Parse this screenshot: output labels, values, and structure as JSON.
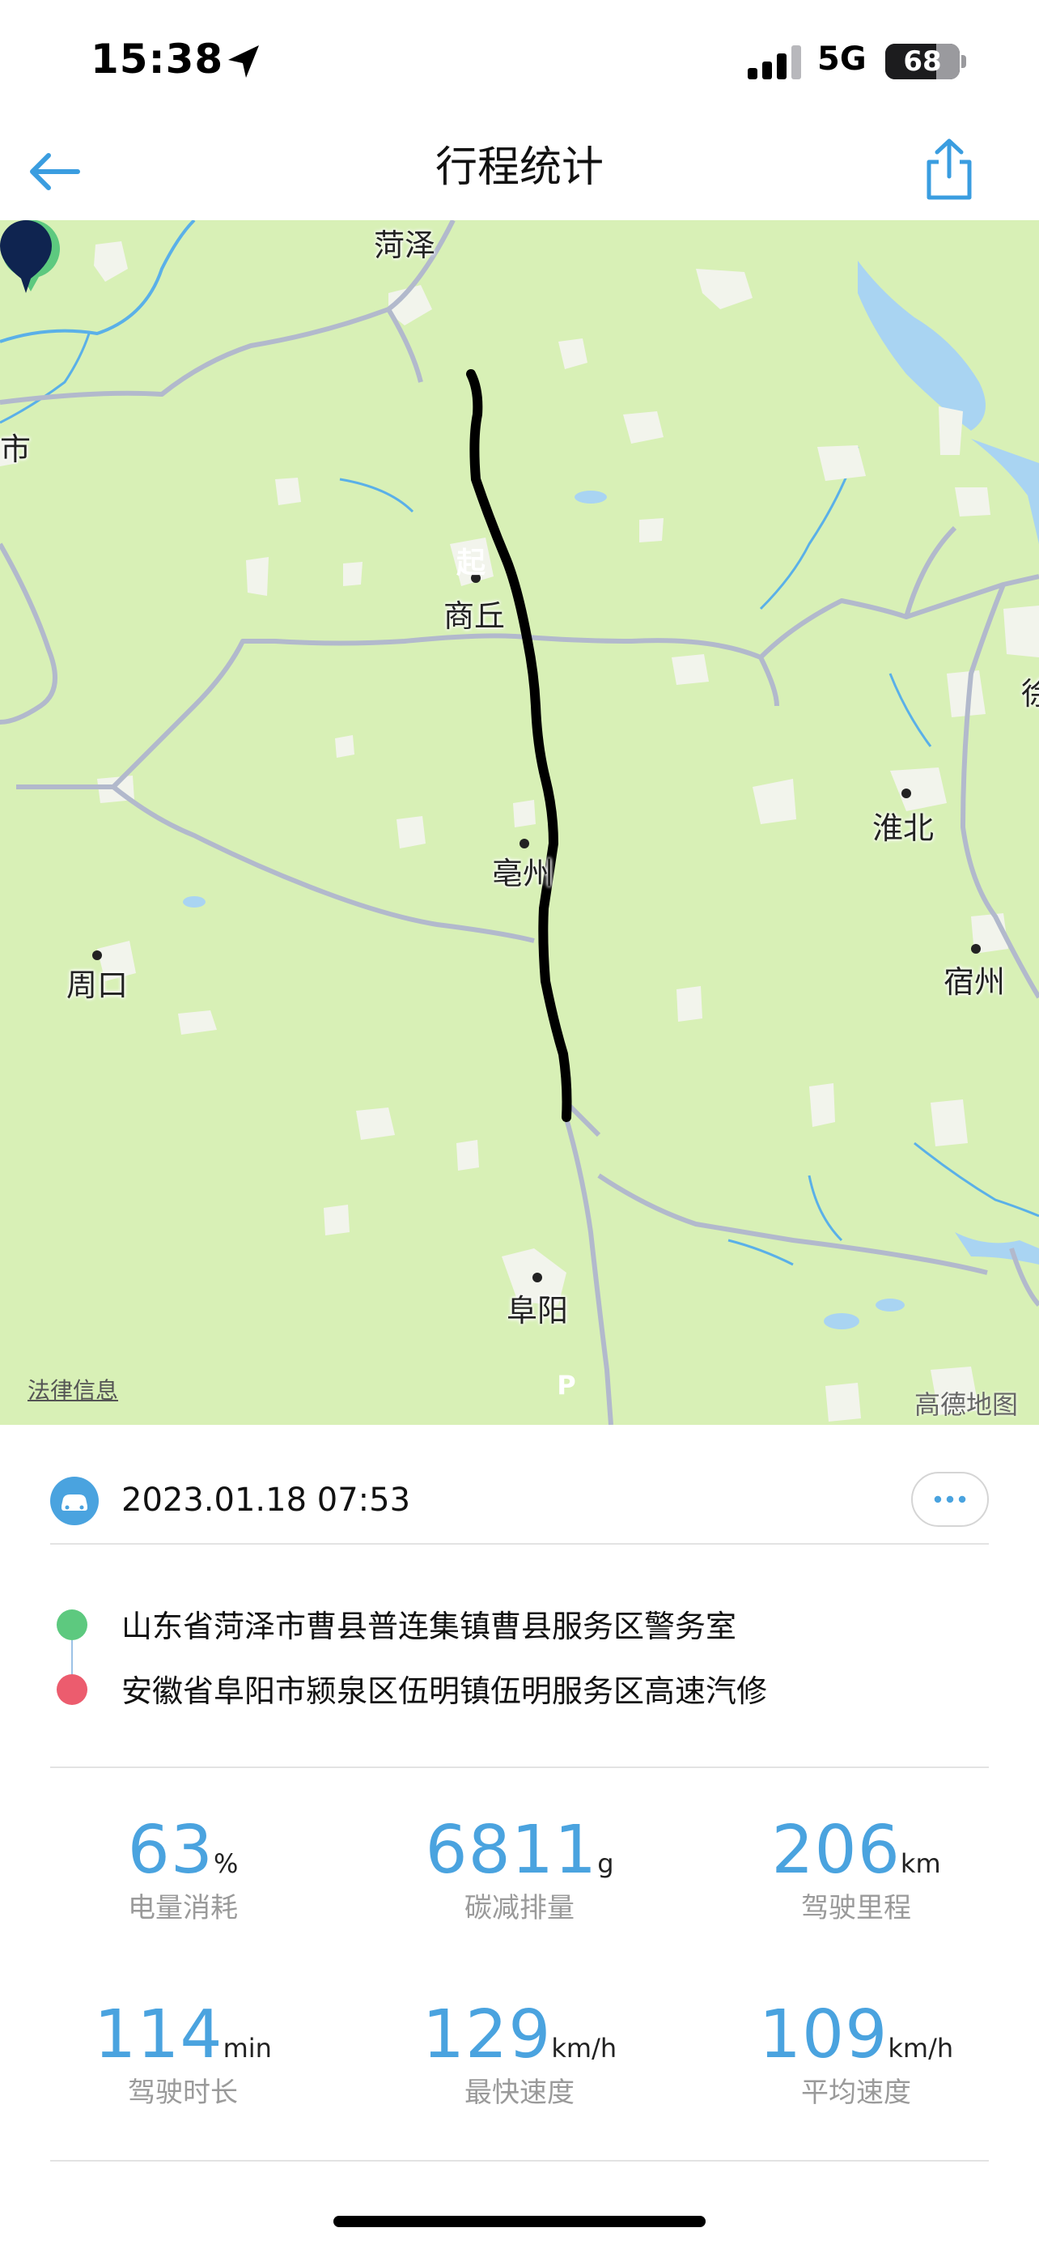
{
  "status_bar": {
    "time": "15:38",
    "network": "5G",
    "battery": "68",
    "battery_level": 0.68
  },
  "header": {
    "title": "行程统计"
  },
  "map": {
    "cities": {
      "heze": "菏泽",
      "shangqiu": "商丘",
      "bozhou": "亳州",
      "zhoukou": "周口",
      "huaibei": "淮北",
      "suzhou": "宿州",
      "fuyang": "阜阳",
      "edge_left": "市",
      "edge_right": "徐"
    },
    "start_marker": "起",
    "end_marker": "P",
    "legal_link": "法律信息",
    "brand": "高德地图"
  },
  "trip": {
    "datetime": "2023.01.18 07:53",
    "start_address": "山东省菏泽市曹县普连集镇曹县服务区警务室",
    "end_address": "安徽省阜阳市颍泉区伍明镇伍明服务区高速汽修"
  },
  "stats": [
    {
      "value": "63",
      "unit": "%",
      "label": "电量消耗"
    },
    {
      "value": "6811",
      "unit": "g",
      "label": "碳减排量"
    },
    {
      "value": "206",
      "unit": "km",
      "label": "驾驶里程"
    },
    {
      "value": "114",
      "unit": "min",
      "label": "驾驶时长"
    },
    {
      "value": "129",
      "unit": "km/h",
      "label": "最快速度"
    },
    {
      "value": "109",
      "unit": "km/h",
      "label": "平均速度"
    }
  ],
  "colors": {
    "accent": "#4aa3df",
    "start_green": "#5dc97f",
    "end_red": "#ec5c6e",
    "map_land": "#d8f0b6",
    "route": "#000000",
    "end_pin": "#0f2450"
  }
}
